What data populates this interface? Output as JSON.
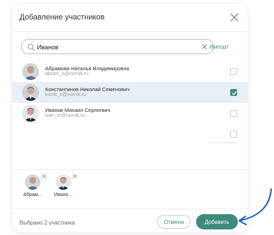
{
  "dialog": {
    "title": "Добавление участников"
  },
  "search": {
    "value": "Иванов",
    "import_label": "Импорт"
  },
  "users": [
    {
      "name": "Абрамова Наталья Владимировна",
      "email": "abram_n@nornik.ru",
      "checked": false
    },
    {
      "name": "Константинов  Николай Семенович",
      "email": "konst_n@nornik.ru",
      "checked": true
    },
    {
      "name": "Иванов Михаил Сергеевич",
      "email": "ivan_m@nornik.ru",
      "checked": false
    }
  ],
  "selected_chips": [
    {
      "label": "Абрам..."
    },
    {
      "label": "Ивано..."
    }
  ],
  "footer": {
    "selected_text": "Выбрано 2 участника",
    "cancel_label": "Отмена",
    "add_label": "Добавить"
  },
  "colors": {
    "accent": "#3e8b7c",
    "selected_row": "#e9eff6",
    "annotation_arrow": "#1f5fb5"
  }
}
